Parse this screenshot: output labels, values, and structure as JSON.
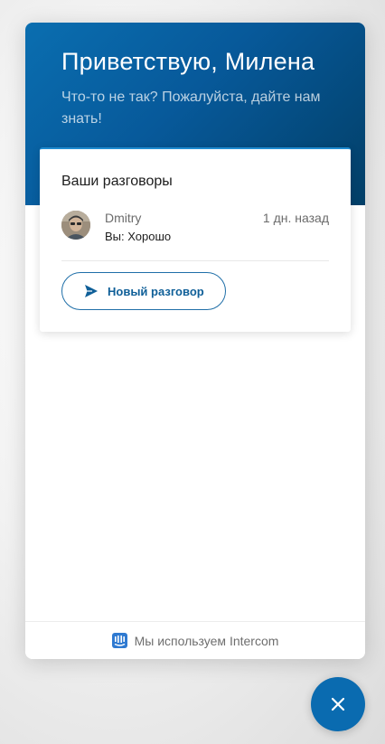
{
  "header": {
    "greeting": "Приветствую, Милена",
    "subtitle": "Что-то не так? Пожалуйста, дайте нам знать!"
  },
  "conversations_card": {
    "title": "Ваши разговоры",
    "items": [
      {
        "name": "Dmitry",
        "time": "1 дн. назад",
        "preview": "Вы: Хорошо",
        "avatar": "user-avatar"
      }
    ],
    "new_conversation_label": "Новый разговор",
    "new_conversation_icon": "send-icon"
  },
  "footer": {
    "text": "Мы используем Intercom",
    "icon": "intercom-logo-icon"
  },
  "launcher": {
    "icon": "close-icon"
  },
  "colors": {
    "brand": "#0a6bb0",
    "header_dark": "#023f67",
    "accent_border": "#1f8bd0"
  }
}
